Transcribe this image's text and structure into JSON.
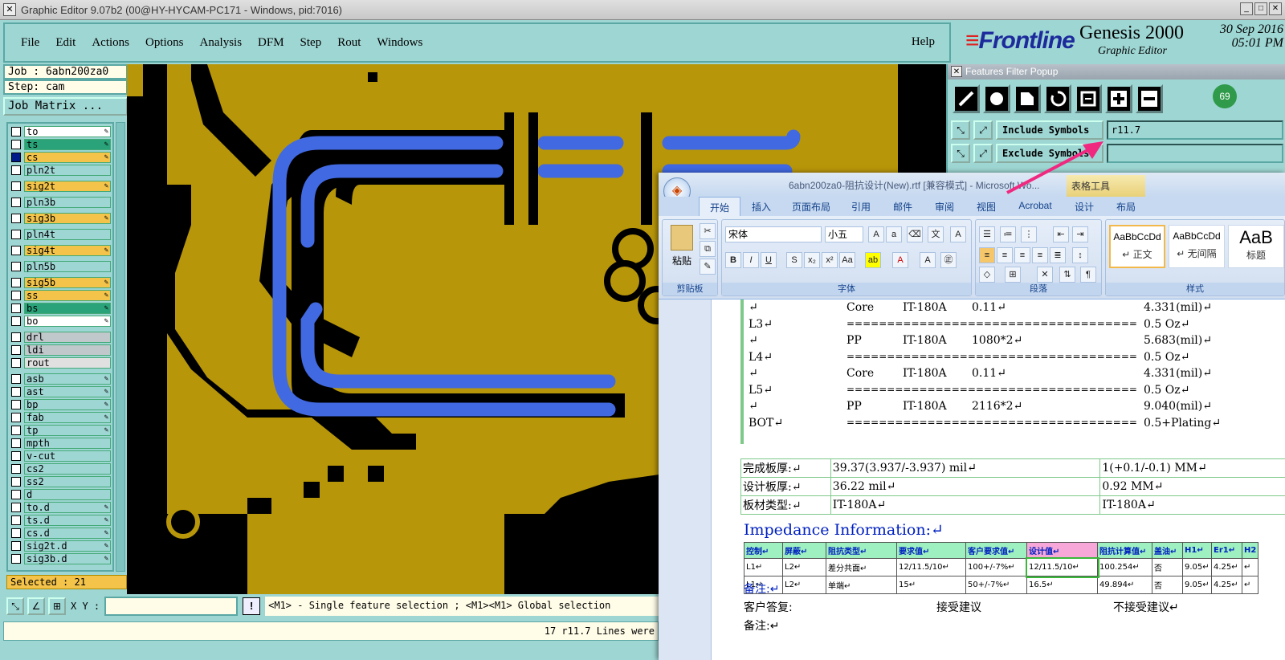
{
  "window": {
    "title": "Graphic Editor 9.07b2 (00@HY-HYCAM-PC171 - Windows, pid:7016)",
    "icon": "x-window-icon"
  },
  "menu": {
    "items": [
      "File",
      "Edit",
      "Actions",
      "Options",
      "Analysis",
      "DFM",
      "Step",
      "Rout",
      "Windows"
    ],
    "help": "Help"
  },
  "brand": {
    "logo": "Frontline",
    "product": "Genesis 2000",
    "subtitle": "Graphic Editor",
    "date": "30 Sep 2016",
    "time": "05:01 PM"
  },
  "job": {
    "job_line": "Job : 6abn200za0",
    "step_line": "Step: cam",
    "matrix_button": "Job Matrix ..."
  },
  "layers": [
    {
      "name": "to",
      "color": "#ffffff",
      "editable": true,
      "gap_before": false
    },
    {
      "name": "ts",
      "color": "#2aa37a",
      "editable": true,
      "gap_before": false
    },
    {
      "name": "cs",
      "color": "#f4c44a",
      "editable": true,
      "gap_before": false,
      "selected": true
    },
    {
      "name": "pln2t",
      "color": "#9ed6d3",
      "editable": false,
      "gap_before": false
    },
    {
      "name": "sig2t",
      "color": "#f4c44a",
      "editable": true,
      "gap_before": true
    },
    {
      "name": "pln3b",
      "color": "#9ed6d3",
      "editable": false,
      "gap_before": true
    },
    {
      "name": "sig3b",
      "color": "#f4c44a",
      "editable": true,
      "gap_before": true
    },
    {
      "name": "pln4t",
      "color": "#9ed6d3",
      "editable": false,
      "gap_before": true
    },
    {
      "name": "sig4t",
      "color": "#f4c44a",
      "editable": true,
      "gap_before": true
    },
    {
      "name": "pln5b",
      "color": "#9ed6d3",
      "editable": false,
      "gap_before": true
    },
    {
      "name": "sig5b",
      "color": "#f4c44a",
      "editable": true,
      "gap_before": true
    },
    {
      "name": "ss",
      "color": "#f4c44a",
      "editable": true,
      "gap_before": false
    },
    {
      "name": "bs",
      "color": "#2aa37a",
      "editable": true,
      "gap_before": false
    },
    {
      "name": "bo",
      "color": "#ffffff",
      "editable": true,
      "gap_before": false
    },
    {
      "name": "drl",
      "color": "#c0c8cc",
      "editable": false,
      "gap_before": true
    },
    {
      "name": "ldi",
      "color": "#c0c8cc",
      "editable": false,
      "gap_before": false
    },
    {
      "name": "rout",
      "color": "#e0e0e0",
      "editable": false,
      "gap_before": false
    },
    {
      "name": "asb",
      "color": "#9ed6d3",
      "editable": true,
      "gap_before": true
    },
    {
      "name": "ast",
      "color": "#9ed6d3",
      "editable": true,
      "gap_before": false
    },
    {
      "name": "bp",
      "color": "#9ed6d3",
      "editable": true,
      "gap_before": false
    },
    {
      "name": "fab",
      "color": "#9ed6d3",
      "editable": true,
      "gap_before": false
    },
    {
      "name": "tp",
      "color": "#9ed6d3",
      "editable": true,
      "gap_before": false
    },
    {
      "name": "mpth",
      "color": "#9ed6d3",
      "editable": false,
      "gap_before": false
    },
    {
      "name": "v-cut",
      "color": "#9ed6d3",
      "editable": false,
      "gap_before": false
    },
    {
      "name": "cs2",
      "color": "#9ed6d3",
      "editable": false,
      "gap_before": false
    },
    {
      "name": "ss2",
      "color": "#9ed6d3",
      "editable": false,
      "gap_before": false
    },
    {
      "name": "d",
      "color": "#9ed6d3",
      "editable": false,
      "gap_before": false
    },
    {
      "name": "to.d",
      "color": "#9ed6d3",
      "editable": true,
      "gap_before": false
    },
    {
      "name": "ts.d",
      "color": "#9ed6d3",
      "editable": true,
      "gap_before": false
    },
    {
      "name": "cs.d",
      "color": "#9ed6d3",
      "editable": true,
      "gap_before": false
    },
    {
      "name": "sig2t.d",
      "color": "#9ed6d3",
      "editable": true,
      "gap_before": false
    },
    {
      "name": "sig3b.d",
      "color": "#9ed6d3",
      "editable": true,
      "gap_before": false
    }
  ],
  "selected": "Selected : 21",
  "bottom": {
    "xy_label": "X Y :",
    "hint": "<M1> - Single feature selection ; <M1><M1> Global selection",
    "status": "17 r11.7 Lines were"
  },
  "filter_popup": {
    "title": "Features Filter Popup",
    "badge": "69",
    "include_label": "Include Symbols :",
    "include_value": "r11.7",
    "exclude_label": "Exclude Symbols"
  },
  "word": {
    "title": "6abn200za0-阻抗设计(New).rtf [兼容模式] - Microsoft Wo...",
    "context_tab": "表格工具",
    "tabs": [
      "开始",
      "插入",
      "页面布局",
      "引用",
      "邮件",
      "审阅",
      "视图",
      "Acrobat",
      "设计",
      "布局"
    ],
    "paste_label": "粘贴",
    "clipboard_label": "剪贴板",
    "font_name": "宋体",
    "font_size": "小五",
    "font_group": "字体",
    "paragraph_group": "段落",
    "styles_group": "样式",
    "styles": [
      {
        "sample": "AaBbCcDd",
        "name": "↵ 正文"
      },
      {
        "sample": "AaBbCcDd",
        "name": "↵ 无间隔"
      },
      {
        "sample": "AaB",
        "name": "标题"
      }
    ],
    "stackup": [
      {
        "layer": "↵",
        "type": "Core",
        "material": "IT-180A",
        "spec": "0.11↵",
        "value": "4.331(mil)↵"
      },
      {
        "layer": "L3↵",
        "type": "",
        "material": "====================================",
        "spec": "",
        "value": "0.5 Oz↵"
      },
      {
        "layer": "↵",
        "type": "PP",
        "material": "IT-180A",
        "spec": "1080*2↵",
        "value": "5.683(mil)↵"
      },
      {
        "layer": "L4↵",
        "type": "",
        "material": "====================================",
        "spec": "",
        "value": "0.5 Oz↵"
      },
      {
        "layer": "↵",
        "type": "Core",
        "material": "IT-180A",
        "spec": "0.11↵",
        "value": "4.331(mil)↵"
      },
      {
        "layer": "L5↵",
        "type": "",
        "material": "====================================",
        "spec": "",
        "value": "0.5 Oz↵"
      },
      {
        "layer": "↵",
        "type": "PP",
        "material": "IT-180A",
        "spec": "2116*2↵",
        "value": "9.040(mil)↵"
      },
      {
        "layer": "BOT↵",
        "type": "",
        "material": "====================================",
        "spec": "",
        "value": "0.5+Plating↵"
      }
    ],
    "board_info": [
      [
        "完成板厚:↵",
        "39.37(3.937/-3.937) mil↵",
        "1(+0.1/-0.1) MM↵"
      ],
      [
        "设计板厚:↵",
        "36.22 mil↵",
        "0.92 MM↵"
      ],
      [
        "板材类型:↵",
        "IT-180A↵",
        "IT-180A↵"
      ]
    ],
    "impedance_title": "Impedance Information:↵",
    "impedance_headers": [
      "控制↵",
      "屏蔽↵",
      "阻抗类型↵",
      "要求值↵",
      "客户要求值↵",
      "设计值↵",
      "阻抗计算值↵",
      "盖油↵",
      "H1↵",
      "Er1↵",
      "H2"
    ],
    "impedance_rows": [
      [
        "L1↵",
        "L2↵",
        "差分共面↵",
        "12/11.5/10↵",
        "100+/-7%↵",
        "12/11.5/10↵",
        "100.254↵",
        "否",
        "9.05↵",
        "4.25↵",
        "↵"
      ],
      [
        "L1↵",
        "L2↵",
        "单端↵",
        "15↵",
        "50+/-7%↵",
        "16.5↵",
        "49.894↵",
        "否",
        "9.05↵",
        "4.25↵",
        "↵"
      ]
    ],
    "remarks_label": "备注:↵",
    "customer_reply": "客户答复:",
    "accept": "接受建议",
    "reject": "不接受建议↵",
    "remarks2": "备注:↵"
  }
}
